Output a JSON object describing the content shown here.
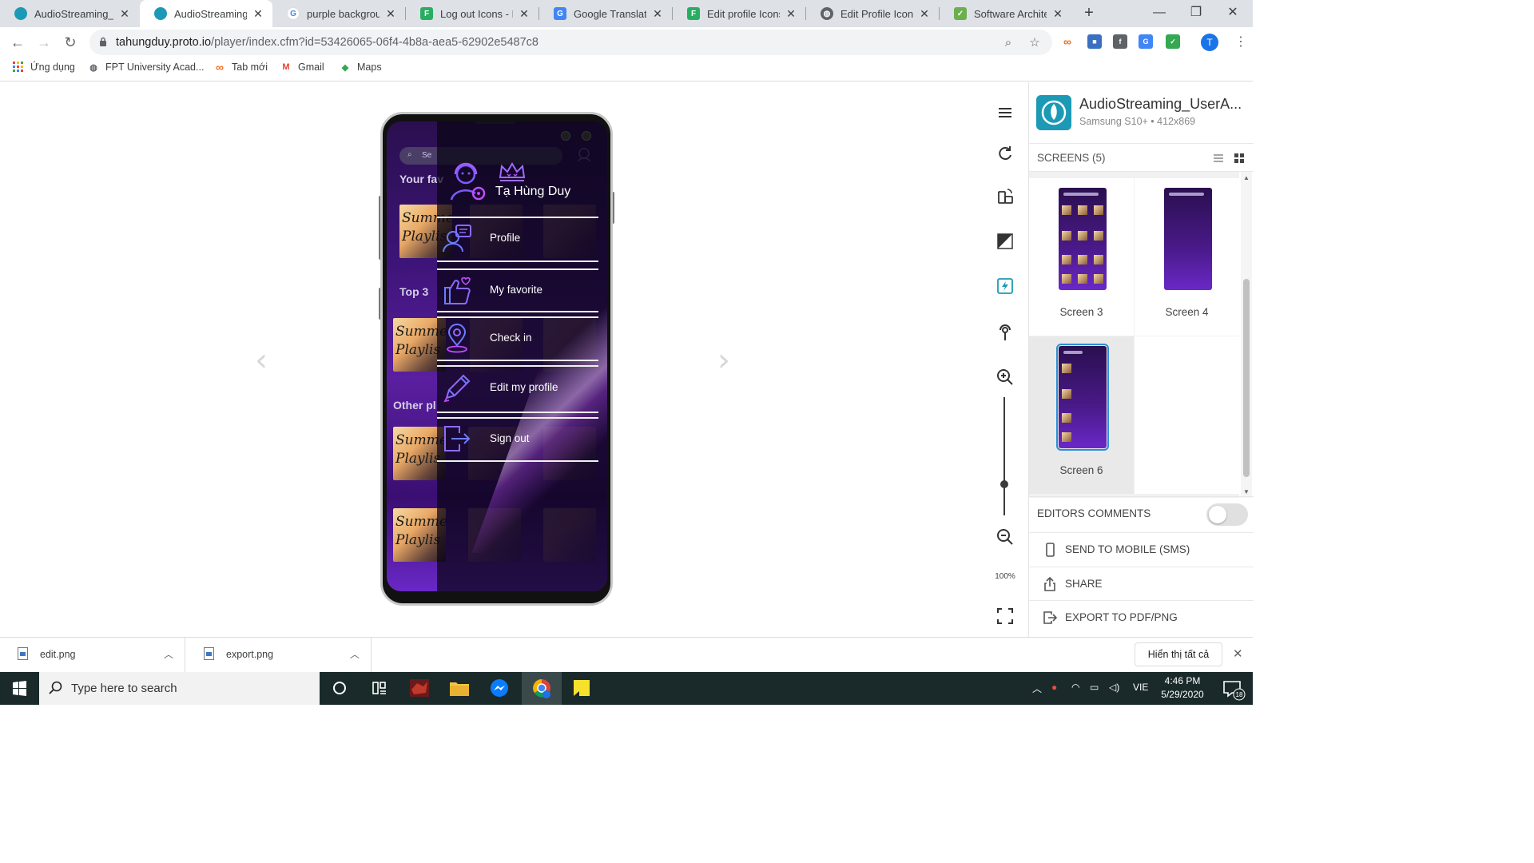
{
  "browser": {
    "tabs": [
      {
        "title": "AudioStreaming_U",
        "icon": "protoio-icon",
        "color": "#1c9ab5"
      },
      {
        "title": "AudioStreaming_U",
        "icon": "protoio-icon",
        "color": "#1c9ab5",
        "active": true
      },
      {
        "title": "purple backgrounc",
        "icon": "google-icon",
        "color": "#4285f4"
      },
      {
        "title": "Log out Icons - Fre",
        "icon": "flaticon-icon",
        "color": "#27ae60"
      },
      {
        "title": "Google Translate",
        "icon": "translate-icon",
        "color": "#4285f4"
      },
      {
        "title": "Edit profile Icons -",
        "icon": "flaticon-icon",
        "color": "#27ae60"
      },
      {
        "title": "Edit Profile Icon - F",
        "icon": "globe-icon",
        "color": "#5f6368"
      },
      {
        "title": "Software Architectu",
        "icon": "leaf-icon",
        "color": "#6ab04c"
      }
    ],
    "url_host": "tahungduy.proto.io",
    "url_path": "/player/index.cfm?id=53426065-06f4-4b8a-aea5-62902e5487c8",
    "profile_initial": "T",
    "bookmarks": [
      {
        "label": "Ứng dụng",
        "icon": "apps-grid-icon"
      },
      {
        "label": "FPT University Acad...",
        "icon": "globe-icon"
      },
      {
        "label": "Tab mới",
        "icon": "infinity-icon"
      },
      {
        "label": "Gmail",
        "icon": "gmail-icon"
      },
      {
        "label": "Maps",
        "icon": "maps-icon"
      }
    ]
  },
  "prototype": {
    "search_placeholder": "Se",
    "sections": [
      "Your fav",
      "Top 3",
      "Other pl"
    ],
    "thumb_text": [
      "Summe",
      "Playlis"
    ],
    "drawer": {
      "user_name": "Tạ Hùng Duy",
      "items": [
        {
          "label": "Profile",
          "icon": "profile-card-icon"
        },
        {
          "label": "My favorite",
          "icon": "thumbs-up-heart-icon"
        },
        {
          "label": "Check in",
          "icon": "location-pin-icon"
        },
        {
          "label": "Edit my profile",
          "icon": "pencil-icon"
        },
        {
          "label": "Sign out",
          "icon": "sign-out-icon"
        }
      ]
    }
  },
  "toolrail": {
    "icons": [
      "menu-icon",
      "refresh-icon",
      "rotate-device-icon",
      "contrast-icon",
      "flash-icon",
      "touch-icon",
      "zoom-in-icon",
      "zoom-out-icon",
      "fullscreen-icon"
    ],
    "zoom_label": "100%"
  },
  "panel": {
    "app_name": "AudioStreaming_UserA...",
    "device": "Samsung S10+ • 412x869",
    "screens_label": "SCREENS (5)",
    "screens": [
      {
        "label": "Screen 3"
      },
      {
        "label": "Screen 4"
      },
      {
        "label": "Screen 6",
        "selected": true
      }
    ],
    "editors_comments": "EDITORS COMMENTS",
    "editors_comments_on": false,
    "send_mobile": "SEND TO MOBILE (SMS)",
    "share": "SHARE",
    "export": "EXPORT TO PDF/PNG"
  },
  "downloads": {
    "files": [
      "edit.png",
      "export.png"
    ],
    "show_all": "Hiển thị tất cả"
  },
  "taskbar": {
    "search_placeholder": "Type here to search",
    "language": "VIE",
    "time": "4:46 PM",
    "date": "5/29/2020",
    "notifications": "18"
  }
}
